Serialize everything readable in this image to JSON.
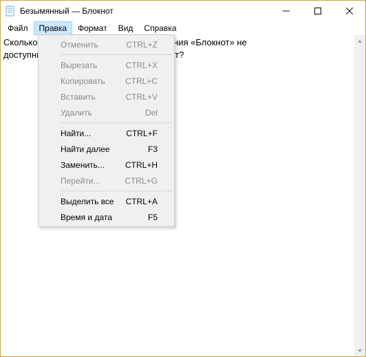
{
  "title": "Безымянный — Блокнот",
  "menubar": {
    "file": "Файл",
    "edit": "Правка",
    "format": "Формат",
    "view": "Вид",
    "help": "Справка"
  },
  "text": {
    "line1": "Сколько пунктов меню «Правка приложения «Блокнот» не",
    "line2": "доступны пользователю в данный момент?"
  },
  "editMenu": {
    "undo": {
      "label": "Отменить",
      "shortcut": "CTRL+Z",
      "enabled": false
    },
    "cut": {
      "label": "Вырезать",
      "shortcut": "CTRL+X",
      "enabled": false
    },
    "copy": {
      "label": "Копировать",
      "shortcut": "CTRL+C",
      "enabled": false
    },
    "paste": {
      "label": "Вставить",
      "shortcut": "CTRL+V",
      "enabled": false
    },
    "delete": {
      "label": "Удалить",
      "shortcut": "Del",
      "enabled": false
    },
    "find": {
      "label": "Найти...",
      "shortcut": "CTRL+F",
      "enabled": true
    },
    "findnext": {
      "label": "Найти далее",
      "shortcut": "F3",
      "enabled": true
    },
    "replace": {
      "label": "Заменить...",
      "shortcut": "CTRL+H",
      "enabled": true
    },
    "goto": {
      "label": "Перейти...",
      "shortcut": "CTRL+G",
      "enabled": false
    },
    "selall": {
      "label": "Выделить все",
      "shortcut": "CTRL+A",
      "enabled": true
    },
    "datetime": {
      "label": "Время и дата",
      "shortcut": "F5",
      "enabled": true
    }
  }
}
